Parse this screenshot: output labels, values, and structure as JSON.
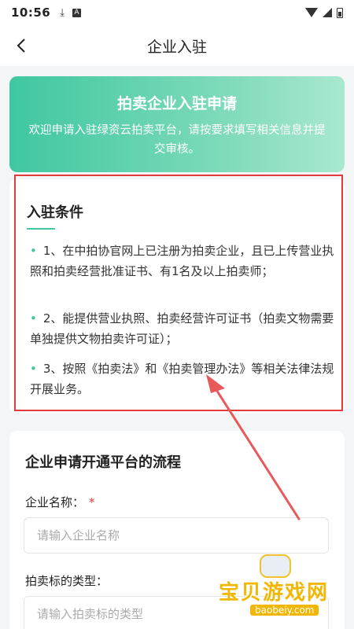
{
  "status_bar": {
    "time": "10:56",
    "download_icon": "download-icon",
    "app_badge": "A"
  },
  "nav": {
    "title": "企业入驻",
    "back_icon": "chevron-left-icon"
  },
  "banner": {
    "title": "拍卖企业入驻申请",
    "subtitle": "欢迎申请入驻绿资云拍卖平台，请按要求填写相关信息并提交审核。"
  },
  "conditions": {
    "title": "入驻条件",
    "items": [
      "1、在中拍协官网上已注册为拍卖企业，且已上传营业执照和拍卖经营批准证书、有1名及以上拍卖师；",
      "2、能提供营业执照、拍卖经营许可证书（拍卖文物需要单独提供文物拍卖许可证）；",
      "3、按照《拍卖法》和《拍卖管理办法》等相关法律法规开展业务。"
    ]
  },
  "process": {
    "title": "企业申请开通平台的流程",
    "fields": [
      {
        "label": "企业名称：",
        "required_mark": "*",
        "placeholder": "请输入企业名称"
      },
      {
        "label": "拍卖标的类型：",
        "placeholder": "请输入拍卖标的类型"
      }
    ]
  },
  "watermark": {
    "text": "宝贝游戏网",
    "url": "baobeiy.com"
  },
  "colors": {
    "accent": "#3fc7a1",
    "highlight": "#e23b3b",
    "watermark": "#f2b705"
  }
}
